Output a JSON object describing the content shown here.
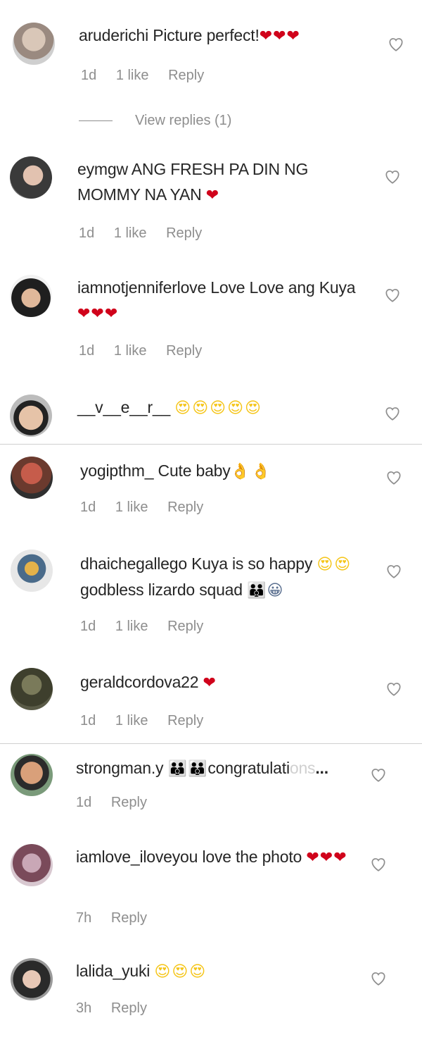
{
  "comments": [
    {
      "username": "aruderichi",
      "text": "Picture perfect!",
      "emoji": "❤❤❤",
      "emoji_type": "heart",
      "time": "1d",
      "likes": "1 like",
      "reply": "Reply"
    },
    {
      "username": "eymgw",
      "text": "ANG FRESH PA DIN NG MOMMY NA YAN",
      "emoji": "❤",
      "emoji_type": "heart",
      "time": "1d",
      "likes": "1 like",
      "reply": "Reply"
    },
    {
      "username": "iamnotjenniferlove",
      "text": "Love Love ang Kuya",
      "emoji": "❤❤❤",
      "emoji_type": "heart",
      "time": "1d",
      "likes": "1 like",
      "reply": "Reply"
    },
    {
      "username": "__v__e__r__",
      "text": "",
      "emoji": "😍😍😍😍😍",
      "emoji_type": "face"
    },
    {
      "username": "yogipthm_",
      "text": "Cute baby",
      "emoji": "👌👌",
      "emoji_type": "hand",
      "time": "1d",
      "likes": "1 like",
      "reply": "Reply"
    },
    {
      "username": "dhaichegallego",
      "text": "Kuya is so happy",
      "emoji": "😍😍",
      "emoji_type": "face",
      "text2": "godbless lizardo squad",
      "emoji2": "👪😀",
      "time": "1d",
      "likes": "1 like",
      "reply": "Reply"
    },
    {
      "username": "geraldcordova22",
      "text": "",
      "emoji": "❤",
      "emoji_type": "heart",
      "time": "1d",
      "likes": "1 like",
      "reply": "Reply"
    },
    {
      "username": "strongman.y",
      "text": "congratulati",
      "emoji": "👪👪",
      "emoji_type": "person",
      "ellipsis": "...",
      "time": "1d",
      "reply": "Reply"
    },
    {
      "username": "iamlove_iloveyou",
      "text": "love the photo",
      "emoji": "❤❤❤",
      "emoji_type": "heart",
      "time": "7h",
      "reply": "Reply"
    },
    {
      "username": "lalida_yuki",
      "text": "",
      "emoji": "😍😍😍",
      "emoji_type": "face",
      "time": "3h",
      "reply": "Reply"
    }
  ],
  "view_replies": "View replies (1)",
  "colors": {
    "heart": "#d0021b",
    "meta": "#8e8e8e",
    "text": "#262626",
    "emoji_face": "#f5c518"
  },
  "icons": {
    "like_button": "heart-outline-icon"
  }
}
